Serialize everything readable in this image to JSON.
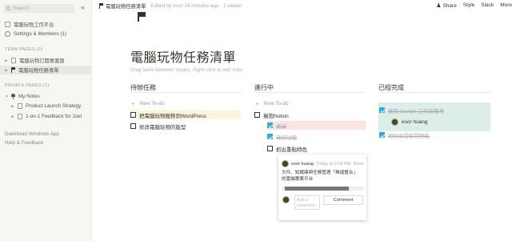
{
  "sidebar": {
    "search_placeholder": "Search",
    "workspace": "電腦玩物工作平台",
    "settings": "Settings & Members (1)",
    "team_title": "TEAM PAGES (2)",
    "team_pages": [
      "電腦玩物訂閱專案頁",
      "電腦玩物任務清單"
    ],
    "private_title": "PRIVATE PAGES (1)",
    "my_notes": "My Notes",
    "notes_children": [
      "Product Launch Strategy",
      "1-on-1 Feedback for Joel"
    ],
    "download": "Download Windows App",
    "help": "Help & Feedback"
  },
  "topbar": {
    "breadcrumb": "電腦玩物任務清單",
    "edited": "Edited by esor 19 minutes ago · 1 viewer",
    "share": "Share",
    "style": "Style",
    "slack": "Slack",
    "more": "More"
  },
  "page": {
    "title": "電腦玩物任務清單",
    "hint": "Drag tasks between stages. Right-click to add color."
  },
  "board": {
    "new_todo": "New To-do",
    "columns": [
      {
        "title": "待辦任務",
        "items": [
          {
            "text": "把電腦玩物搬移到WordPress",
            "checked": false,
            "highlight": "yellow"
          },
          {
            "text": "修改電腦玩物的版型",
            "checked": false
          }
        ]
      },
      {
        "title": "進行中",
        "items": [
          {
            "text": "擁抱Notion",
            "checked": false
          },
          {
            "text": "測試",
            "checked": true,
            "highlight": "red"
          },
          {
            "text": "寫好功能",
            "checked": true
          },
          {
            "text": "抓出重點特色",
            "checked": false
          }
        ]
      },
      {
        "title": "已經完成",
        "items": [
          {
            "text": "擁抱 Google 工作新思考",
            "checked": true
          },
          {
            "text": "esor huang",
            "checked": false
          },
          {
            "text": "相約享受智慧輕鬆",
            "checked": true
          }
        ]
      }
    ]
  },
  "comment": {
    "author": "esor huang",
    "time": "Today at 2:04 PM",
    "time_extra": "Revo",
    "body": "文件、知識庫與任務管理「無縫整合」的雲端專案平台",
    "placeholder": "Add a comment...",
    "button": "Comment"
  }
}
